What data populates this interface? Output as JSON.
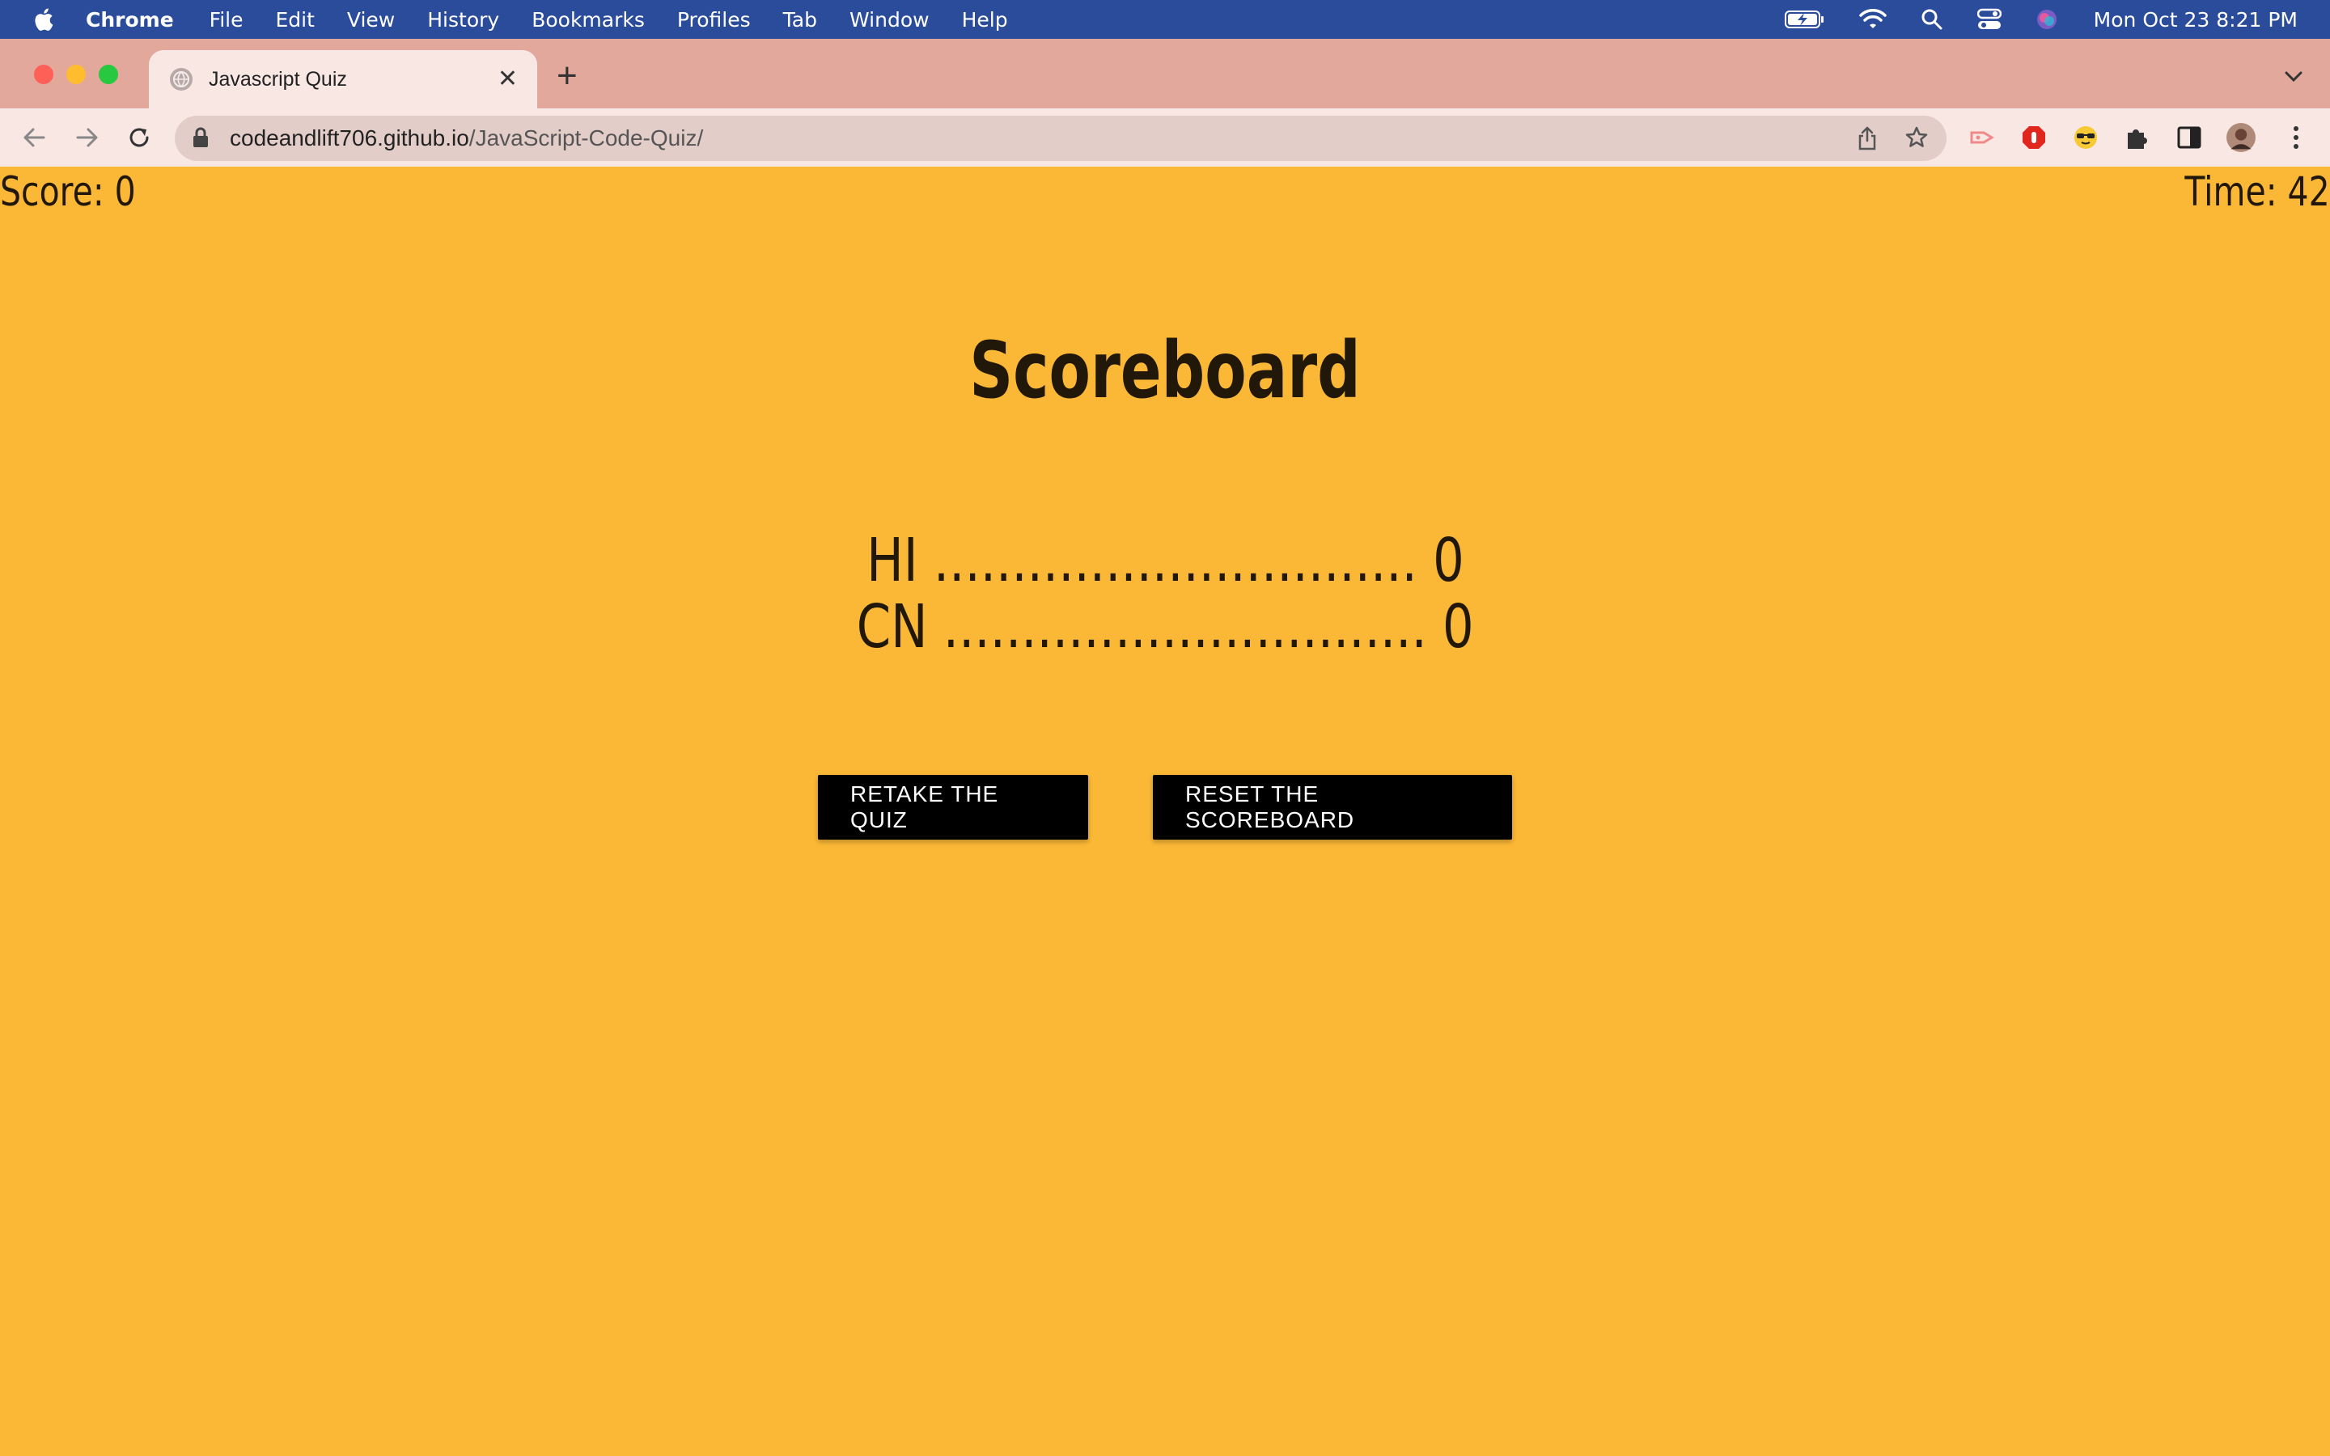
{
  "menubar": {
    "app_name": "Chrome",
    "items": [
      "File",
      "Edit",
      "View",
      "History",
      "Bookmarks",
      "Profiles",
      "Tab",
      "Window",
      "Help"
    ],
    "clock": "Mon Oct 23  8:21 PM"
  },
  "browser": {
    "tab_title": "Javascript Quiz",
    "url_host": "codeandlift706.github.io",
    "url_path": "/JavaScript-Code-Quiz/"
  },
  "page": {
    "score_label": "Score: 0",
    "time_label": "Time: 42",
    "heading": "Scoreboard",
    "scores": [
      {
        "initials": "HI",
        "dots": "...............................",
        "score": "0"
      },
      {
        "initials": "CN",
        "dots": "...............................",
        "score": "0"
      }
    ],
    "retake_label": "RETAKE THE QUIZ",
    "reset_label": "RESET THE SCOREBOARD"
  },
  "colors": {
    "page_background": "#fbb836",
    "menubar": "#2a4c9b",
    "tabstrip": "#e2a89b",
    "button": "#000000"
  }
}
